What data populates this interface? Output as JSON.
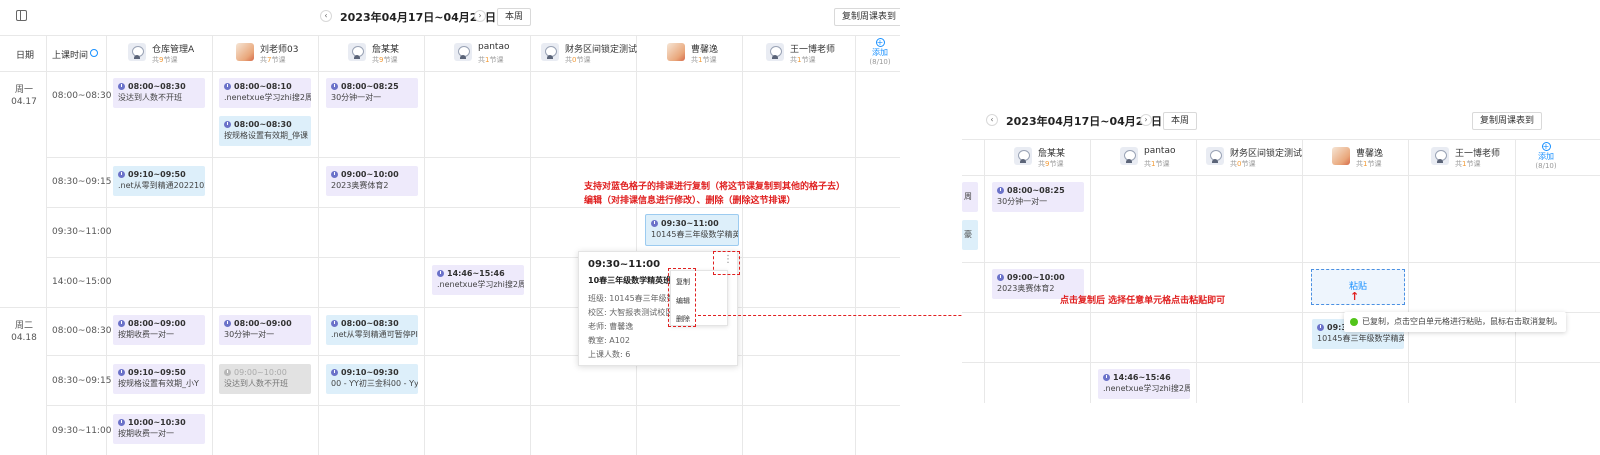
{
  "toolbar": {
    "date_range": "2023年04月17日~04月23日",
    "this_week": "本周",
    "copy_btn": "复制周课表到",
    "prev": "‹",
    "next": "›"
  },
  "header": {
    "date_col": "日期",
    "time_col": "上课时间",
    "add": "添加",
    "add_count": "(8/10)"
  },
  "teachers": [
    {
      "name": "仓库管理A",
      "pre": "共",
      "num": "9",
      "post": "节课"
    },
    {
      "name": "刘老师03",
      "pre": "共",
      "num": "7",
      "post": "节课"
    },
    {
      "name": "詹某某",
      "pre": "共",
      "num": "9",
      "post": "节课"
    },
    {
      "name": "pantao",
      "pre": "共",
      "num": "1",
      "post": "节课"
    },
    {
      "name": "财务区间锁定测试",
      "pre": "共",
      "num": "0",
      "post": "节课"
    },
    {
      "name": "曹馨逸",
      "pre": "共",
      "num": "1",
      "post": "节课"
    },
    {
      "name": "王一博老师",
      "pre": "共",
      "num": "1",
      "post": "节课"
    }
  ],
  "days": [
    {
      "weekday": "周一",
      "date": "04.17"
    },
    {
      "weekday": "周二",
      "date": "04.18"
    }
  ],
  "times": [
    "08:00~08:30",
    "08:30~09:15",
    "09:30~11:00",
    "14:00~15:00",
    "08:00~08:30",
    "08:30~09:15",
    "09:30~11:00"
  ],
  "cards": [
    {
      "time": "08:00~08:30",
      "name": "没达到人数不开班"
    },
    {
      "time": "08:00~08:10",
      "name": ".nenetxue学习zhi搜2周"
    },
    {
      "time": "08:00~08:30",
      "name": "按规格设置有效期_停课"
    },
    {
      "time": "08:00~08:25",
      "name": "30分钟一对一"
    },
    {
      "time": "09:10~09:50",
      "name": ".net从零到精通2022102"
    },
    {
      "time": "09:00~10:00",
      "name": "2023奥赛体育2"
    },
    {
      "time": "09:30~11:00",
      "name": "10145春三年级数学精英"
    },
    {
      "time": "14:46~15:46",
      "name": ".nenetxue学习zhi搜2周"
    },
    {
      "time": "08:00~09:00",
      "name": "按期收费一对一"
    },
    {
      "time": "08:00~09:00",
      "name": "30分钟一对一"
    },
    {
      "time": "08:00~08:30",
      "name": ".net从零到精通可暂停PI"
    },
    {
      "time": "09:10~09:50",
      "name": "按规格设置有效期_小Y"
    },
    {
      "time": "09:00~10:00",
      "name": "没达到人数不开班"
    },
    {
      "time": "09:10~09:30",
      "name": "00 - YY初三金科00 - Yy"
    },
    {
      "time": "10:00~10:30",
      "name": "按期收费一对一"
    }
  ],
  "popup": {
    "time": "09:30~11:00",
    "title": "10春三年级数学精英班",
    "class": "班级: 10145春三年级数",
    "campus": "校区: 大智报表测试校区",
    "teacher": "老师: 曹馨逸",
    "room": "教室: A102",
    "count": "上课人数: 6"
  },
  "menu": {
    "copy": "复制",
    "edit": "编辑",
    "delete": "删除",
    "more": "⋮"
  },
  "annotations": {
    "a1_line1": "支持对蓝色格子的排课进行复制（将这节课复制到其他的格子去）",
    "a1_line2": "编辑（对排课信息进行修改）、删除（删除这节排课）",
    "a2": "点击复制后 选择任意单元格点击粘贴即可"
  },
  "right": {
    "date_range": "2023年04月17日~04月23日",
    "this_week": "本周",
    "copy_btn": "复制周课表到",
    "teachers": [
      {
        "name": "詹某某",
        "pre": "共",
        "num": "9",
        "post": "节课"
      },
      {
        "name": "pantao",
        "pre": "共",
        "num": "1",
        "post": "节课"
      },
      {
        "name": "财务区间锁定测试",
        "pre": "共",
        "num": "0",
        "post": "节课"
      },
      {
        "name": "曹馨逸",
        "pre": "共",
        "num": "1",
        "post": "节课"
      },
      {
        "name": "王一博老师",
        "pre": "共",
        "num": "1",
        "post": "节课"
      }
    ],
    "frag_1": "周",
    "frag_2": "豪",
    "cards": [
      {
        "time": "08:00~08:25",
        "name": "30分钟一对一"
      },
      {
        "time": "09:00~10:00",
        "name": "2023奥赛体育2"
      },
      {
        "time": "09:30~11:00",
        "name": "10145春三年级数学精英"
      },
      {
        "time": "14:46~15:46",
        "name": ".nenetxue学习zhi搜2周"
      }
    ],
    "paste": "粘贴",
    "paste_arrow": "↑",
    "toast": "已复制，点击空白单元格进行粘贴，鼠标右击取消复制。",
    "add": "添加",
    "add_count": "(8/10)"
  },
  "colors": {
    "accent": "#1890ff",
    "annotation": "#e02020",
    "purple_card": "#eeeafb",
    "blue_card": "#ddeffa",
    "gray_card": "#e2e2e2"
  }
}
